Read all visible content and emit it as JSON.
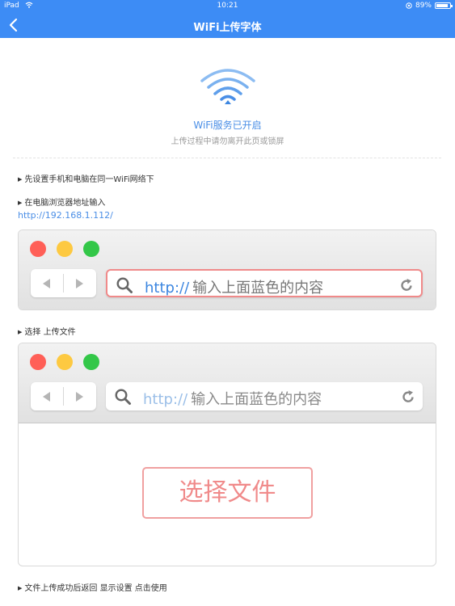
{
  "status_bar": {
    "device": "iPad",
    "time": "10:21",
    "battery": "89%",
    "battery_level": 0.89
  },
  "nav": {
    "title": "WiFi上传字体"
  },
  "hero": {
    "title": "WiFi服务已开启",
    "subtitle": "上传过程中请勿离开此页或锁屏"
  },
  "steps": {
    "step1": "先设置手机和电脑在同一WiFi网络下",
    "step2": "在电脑浏览器地址输入",
    "url": "http://192.168.1.112/",
    "step3": "选择 上传文件",
    "step4": "文件上传成功后返回 显示设置 点击使用"
  },
  "browser1": {
    "protocol": "http://",
    "hint": "输入上面蓝色的内容"
  },
  "browser2": {
    "protocol": "http://",
    "hint": "输入上面蓝色的内容",
    "choose_label": "选择文件"
  },
  "colors": {
    "brand": "#3d8cf5",
    "link": "#4a8ee6",
    "accent_red": "#f08a8a"
  },
  "icons": {
    "back": "chevron-left-icon",
    "wifi": "wifi-icon",
    "search": "search-icon",
    "reload": "reload-icon",
    "arrow_left": "triangle-left-icon",
    "arrow_right": "triangle-right-icon"
  }
}
